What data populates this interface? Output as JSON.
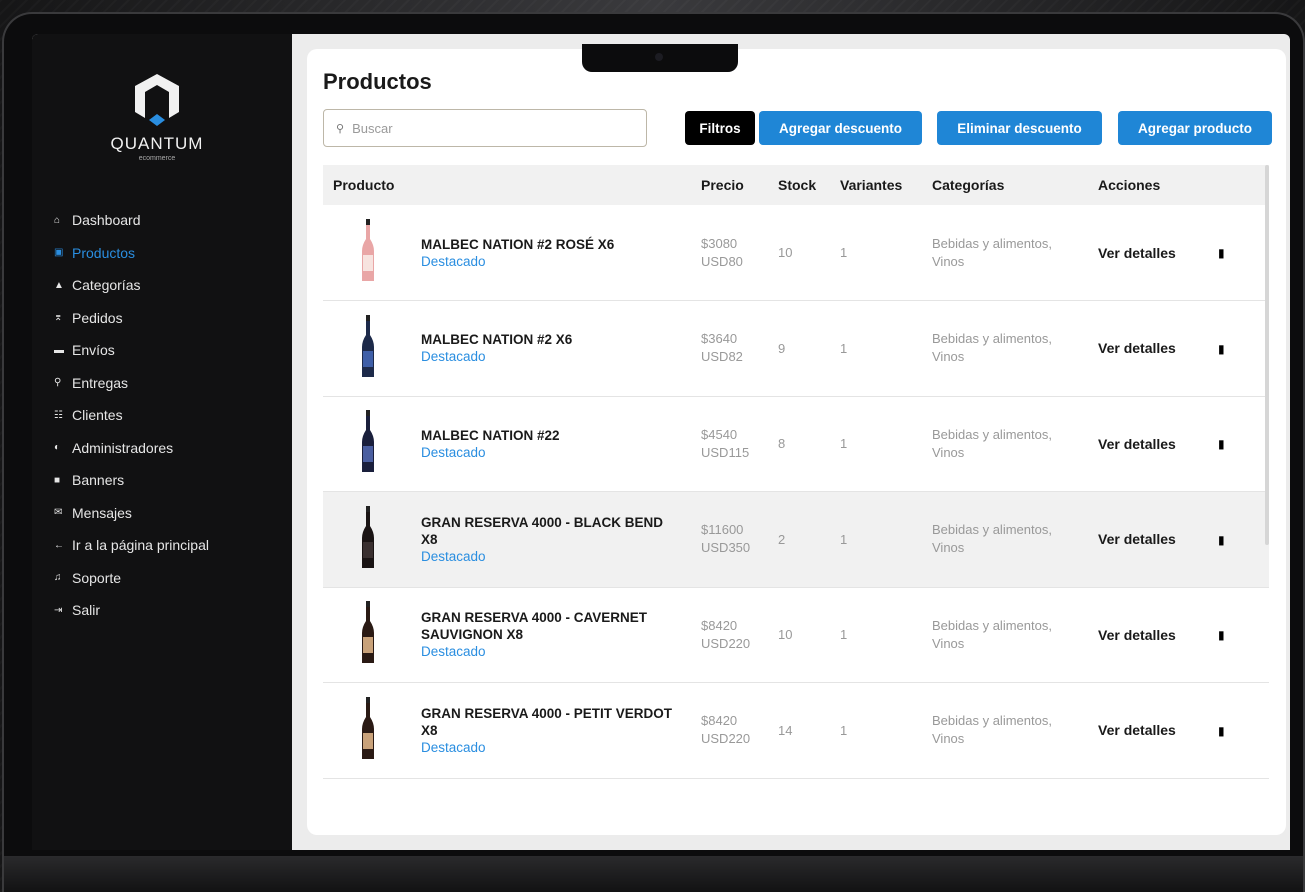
{
  "brand": {
    "name": "QUANTUM",
    "sub": "ecommerce"
  },
  "nav": [
    {
      "icon": "home-icon",
      "glyph": "⌂",
      "label": "Dashboard",
      "active": false
    },
    {
      "icon": "box-icon",
      "glyph": "▣",
      "label": "Productos",
      "active": true
    },
    {
      "icon": "shapes-icon",
      "glyph": "▲",
      "label": "Categorías",
      "active": false
    },
    {
      "icon": "dolly-icon",
      "glyph": "⌆",
      "label": "Pedidos",
      "active": false
    },
    {
      "icon": "truck-icon",
      "glyph": "▬",
      "label": "Envíos",
      "active": false
    },
    {
      "icon": "delivery-person-icon",
      "glyph": "⚲",
      "label": "Entregas",
      "active": false
    },
    {
      "icon": "users-icon",
      "glyph": "☷",
      "label": "Clientes",
      "active": false
    },
    {
      "icon": "admin-icon",
      "glyph": "◐",
      "label": "Administradores",
      "active": false
    },
    {
      "icon": "image-icon",
      "glyph": "■",
      "label": "Banners",
      "active": false
    },
    {
      "icon": "envelope-icon",
      "glyph": "✉",
      "label": "Mensajes",
      "active": false
    },
    {
      "icon": "arrow-left-icon",
      "glyph": "←",
      "label": "Ir a la página principal",
      "active": false
    },
    {
      "icon": "headset-icon",
      "glyph": "♫",
      "label": "Soporte",
      "active": false
    },
    {
      "icon": "logout-icon",
      "glyph": "⇥",
      "label": "Salir",
      "active": false
    }
  ],
  "page": {
    "title": "Productos",
    "search_placeholder": "Buscar",
    "buttons": {
      "filters": "Filtros",
      "add_discount": "Agregar descuento",
      "remove_discount": "Eliminar descuento",
      "add_product": "Agregar producto"
    }
  },
  "table": {
    "headers": [
      "Producto",
      "Precio",
      "Stock",
      "Variantes",
      "Categorías",
      "Acciones"
    ],
    "rows": [
      {
        "name": "MALBEC NATION #2 ROSÉ X6",
        "tag": "Destacado",
        "price_ars": "$3080",
        "price_usd": "USD80",
        "stock": "10",
        "variants": "1",
        "cat1": "Bebidas y alimentos,",
        "cat2": "Vinos",
        "action": "Ver detalles",
        "bottle": "#e9a6a6",
        "label": "#f7e3df",
        "highlight": false
      },
      {
        "name": "MALBEC NATION #2 X6",
        "tag": "Destacado",
        "price_ars": "$3640",
        "price_usd": "USD82",
        "stock": "9",
        "variants": "1",
        "cat1": "Bebidas y alimentos,",
        "cat2": "Vinos",
        "action": "Ver detalles",
        "bottle": "#1d2a4a",
        "label": "#3f5fa8",
        "highlight": false
      },
      {
        "name": "MALBEC NATION #22",
        "tag": "Destacado",
        "price_ars": "$4540",
        "price_usd": "USD115",
        "stock": "8",
        "variants": "1",
        "cat1": "Bebidas y alimentos,",
        "cat2": "Vinos",
        "action": "Ver detalles",
        "bottle": "#1a1f3c",
        "label": "#4a5ea0",
        "highlight": false
      },
      {
        "name": "GRAN RESERVA 4000 - BLACK BEND X8",
        "tag": "Destacado",
        "price_ars": "$11600",
        "price_usd": "USD350",
        "stock": "2",
        "variants": "1",
        "cat1": "Bebidas y alimentos,",
        "cat2": "Vinos",
        "action": "Ver detalles",
        "bottle": "#1a1414",
        "label": "#3a3030",
        "highlight": true
      },
      {
        "name": "GRAN RESERVA 4000 - CAVERNET SAUVIGNON X8",
        "tag": "Destacado",
        "price_ars": "$8420",
        "price_usd": "USD220",
        "stock": "10",
        "variants": "1",
        "cat1": "Bebidas y alimentos,",
        "cat2": "Vinos",
        "action": "Ver detalles",
        "bottle": "#2a1a14",
        "label": "#c9a27a",
        "highlight": false
      },
      {
        "name": "GRAN RESERVA 4000 - PETIT VERDOT X8",
        "tag": "Destacado",
        "price_ars": "$8420",
        "price_usd": "USD220",
        "stock": "14",
        "variants": "1",
        "cat1": "Bebidas y alimentos,",
        "cat2": "Vinos",
        "action": "Ver detalles",
        "bottle": "#2a1a14",
        "label": "#c9a27a",
        "highlight": false
      }
    ]
  },
  "colors": {
    "accent": "#2a8ee0",
    "button_blue": "#1f86d6",
    "sidebar": "#111112"
  }
}
